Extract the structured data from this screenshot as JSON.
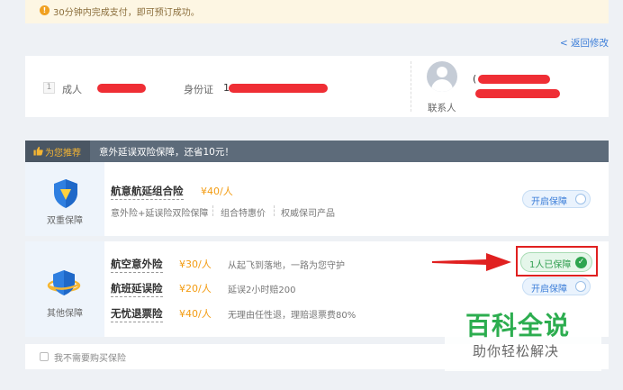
{
  "notice": {
    "icon": "info-icon",
    "text": "30分钟内完成支付，即可预订成功。"
  },
  "back_link": "< 返回修改",
  "passenger": {
    "index": "1",
    "type": "成人",
    "id_label": "身份证",
    "id_prefix": "1",
    "contact_label": "联系人",
    "contact_prefix": "("
  },
  "recommend": {
    "badge": "为您推荐",
    "title": "意外延误双险保障，还省10元！"
  },
  "combo": {
    "category": "双重保障",
    "name": "航意航延组合险",
    "price": "¥40/人",
    "features": [
      "意外险+延误险双险保障",
      "组合特惠价",
      "权威保司产品"
    ],
    "toggle_label": "开启保障"
  },
  "others": {
    "category": "其他保障",
    "items": [
      {
        "name": "航空意外险",
        "price": "¥30/人",
        "desc": "从起飞到落地，一路为您守护"
      },
      {
        "name": "航班延误险",
        "price": "¥20/人",
        "desc": "延误2小时赔200"
      },
      {
        "name": "无忧退票险",
        "price": "¥40/人",
        "desc": "无理由任性退，理赔退票费80%"
      }
    ],
    "protected_label": "1人已保障",
    "toggle_label": "开启保障"
  },
  "optout": {
    "label": "我不需要购买保险"
  },
  "watermark": {
    "title": "百科全说",
    "subtitle": "助你轻松解决"
  },
  "colors": {
    "accent": "#3b7dd8",
    "price": "#f39c12",
    "success": "#2ea44f",
    "header": "#5d6b7a",
    "highlight": "#e02020"
  }
}
